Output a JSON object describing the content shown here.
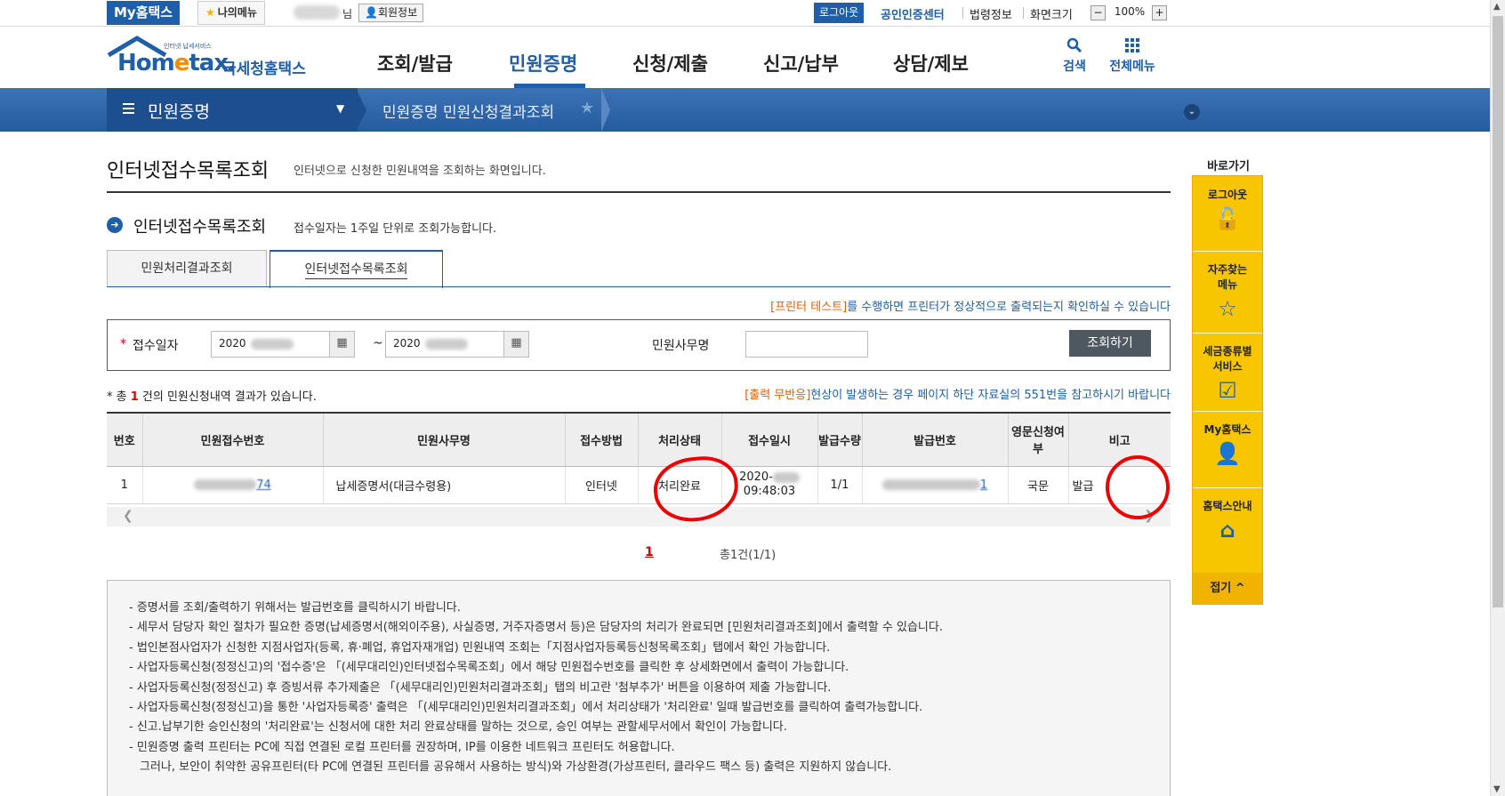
{
  "topbar": {
    "my_hometax": "My홈택스",
    "my_menu": "나의메뉴",
    "user_suffix": "님",
    "member_info": "회원정보",
    "logout": "로그아웃",
    "cert_center": "공인인증센터",
    "law_info": "법령정보",
    "screen_size": "화면크기",
    "zoom_minus": "−",
    "zoom_level": "100%",
    "zoom_plus": "+"
  },
  "logo": {
    "brand_a": "Hom",
    "brand_e": "e",
    "brand_b": "tax.",
    "name": "국세청홈택스",
    "tagline": "인터넷 납세서비스"
  },
  "gnb": [
    "조회/발급",
    "민원증명",
    "신청/제출",
    "신고/납부",
    "상담/제보"
  ],
  "header_icons": {
    "search": "검색",
    "all_menu": "전체메뉴"
  },
  "location": {
    "title": "민원증명",
    "path": "민원증명 민원신청결과조회"
  },
  "page": {
    "title": "인터넷접수목록조회",
    "desc": "인터넷으로 신청한 민원내역을 조회하는 화면입니다.",
    "section_title": "인터넷접수목록조회",
    "section_desc": "접수일자는 1주일 단위로 조회가능합니다."
  },
  "tabs": [
    "민원처리결과조회",
    "인터넷접수목록조회"
  ],
  "notice_printer": {
    "highlight": "[프린터 테스트]",
    "rest": "를 수행하면 프린터가 정상적으로 출력되는지 확인하실 수 있습니다"
  },
  "search": {
    "date_label": "접수일자",
    "date_from": "2020",
    "date_to": "2020",
    "tilde": "~",
    "office_label": "민원사무명",
    "office_value": "",
    "button": "조회하기"
  },
  "result": {
    "prefix": "* 총",
    "count": "1",
    "suffix": "건의 민원신청내역 결과가 있습니다."
  },
  "notice_output": {
    "highlight": "[출력 무반응]",
    "rest": "현상이 발생하는 경우 페이지 하단 자료실의 551번을 참고하시기 바랍니다"
  },
  "table": {
    "headers": [
      "번호",
      "민원접수번호",
      "민원사무명",
      "접수방법",
      "처리상태",
      "접수일시",
      "발급수량",
      "발급번호",
      "영문신청여부",
      "비고"
    ],
    "rows": [
      {
        "no": "1",
        "receipt_no_tail": "74",
        "office": "납세증명서(대금수령용)",
        "method": "인터넷",
        "status": "처리완료",
        "date": "2020-",
        "time": "09:48:03",
        "qty": "1/1",
        "issue_no_tail": "1",
        "english": "국문",
        "note": "발급"
      }
    ]
  },
  "pager": {
    "current": "1",
    "total": "총1건(1/1)"
  },
  "info": [
    "- 증명서를 조회/출력하기 위해서는 발급번호를 클릭하시기 바랍니다.",
    "- 세무서 담당자 확인 절차가 필요한 증명(납세증명서(해외이주용), 사실증명, 거주자증명서 등)은 담당자의 처리가 완료되면 [민원처리결과조회]에서 출력할 수 있습니다.",
    "- 법인본점사업자가 신청한 지점사업자(등록, 휴·폐업, 휴업자재개업) 민원내역 조회는「지점사업자등록등신청목록조회」탭에서 확인 가능합니다.",
    "- 사업자등록신청(정정신고)의 '접수증'은 「(세무대리인)인터넷접수목록조회」에서 해당 민원접수번호를 클릭한 후 상세화면에서 출력이 가능합니다.",
    "- 사업자등록신청(정정신고) 후 증빙서류 추가제출은 「(세무대리인)민원처리결과조회」탭의 비고란 '첨부추가' 버튼을 이용하여 제출 가능합니다.",
    "- 사업자등록신청(정정신고)을 통한 '사업자등록증' 출력은 「(세무대리인)민원처리결과조회」에서 처리상태가 '처리완료' 일때 발급번호를 클릭하여 출력가능합니다.",
    "- 신고.납부기한 승인신청의 '처리완료'는 신청서에 대한 처리 완료상태를 말하는 것으로, 승인 여부는 관할세무서에서 확인이 가능합니다.",
    "- 민원증명 출력 프린터는 PC에 직접 연결된 로컬 프린터를 권장하며, IP를 이용한 네트워크 프린터도 허용합니다.",
    "그러나, 보안이 취약한 공유프린터(타 PC에 연결된 프린터를 공유해서 사용하는 방식)와 가상환경(가상프린터, 클라우드 팩스 등) 출력은 지원하지 않습니다."
  ],
  "quick": {
    "title": "바로가기",
    "items": [
      "로그아웃",
      "자주찾는 메뉴",
      "세금종류별 서비스",
      "My홈택스",
      "홈택스안내"
    ],
    "fold": "접기 ^"
  },
  "colors": {
    "brand_blue": "#1f5ea8",
    "quick_yellow": "#f7c600",
    "annotation_red": "#e00000"
  }
}
